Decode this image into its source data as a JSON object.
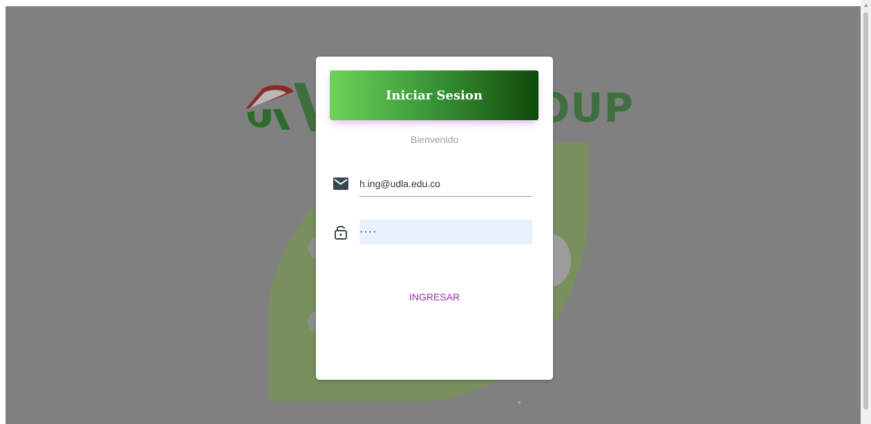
{
  "background": {
    "logo_text": "OUP"
  },
  "login": {
    "title": "Iniciar Sesion",
    "subtitle": "Bienvenido",
    "email_value": "h.ing@udla.edu.co",
    "password_value": "····",
    "submit_label": "INGRESAR"
  },
  "icons": {
    "email": "mail-icon",
    "password": "lock-icon"
  },
  "colors": {
    "accent": "#9c27b0",
    "header_gradient_start": "#6ed35a",
    "header_gradient_end": "#0f4a0a",
    "overlay": "#808080"
  }
}
